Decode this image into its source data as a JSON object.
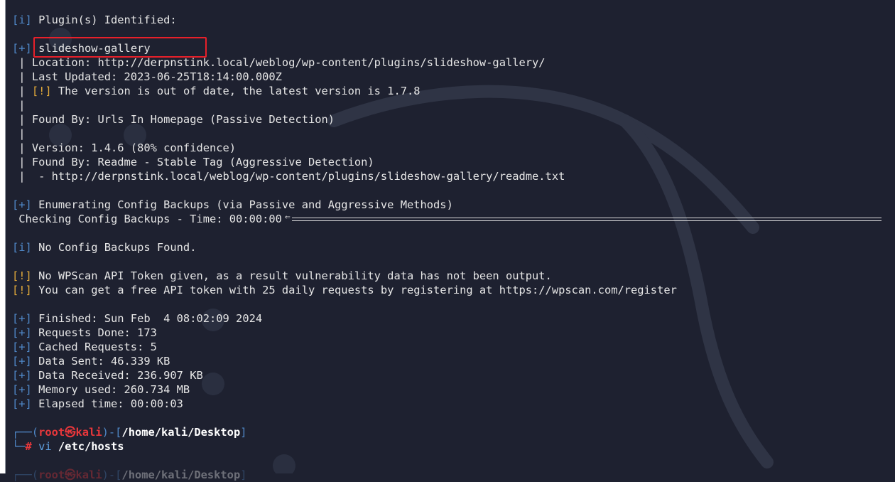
{
  "colors": {
    "background": "#1e2130",
    "tag": "#4f87c6",
    "warning": "#e0a83a",
    "highlight_box": "#e8202a",
    "prompt_root": "#e8373b"
  },
  "terminal": {
    "plugins_header": {
      "tag": "[i]",
      "text": " Plugin(s) Identified:"
    },
    "plugin": {
      "tag": "[+]",
      "name": "slideshow-gallery"
    },
    "details": {
      "location": " Location: http://derpnstink.local/weblog/wp-content/plugins/slideshow-gallery/",
      "last_updated": " Last Updated: 2023-06-25T18:14:00.000Z",
      "outdated_tag": "[!]",
      "outdated_text": " The version is out of date, the latest version is 1.7.8",
      "found_by_1": " Found By: Urls In Homepage (Passive Detection)",
      "version": " Version: 1.4.6 (80% confidence)",
      "found_by_2": " Found By: Readme - Stable Tag (Aggressive Detection)",
      "readme_url": "  - http://derpnstink.local/weblog/wp-content/plugins/slideshow-gallery/readme.txt"
    },
    "config": {
      "tag": "[+]",
      "enumerating": " Enumerating Config Backups (via Passive and Aggressive Methods)",
      "checking": " Checking Config Backups - Time: 00:00:00",
      "none_tag": "[i]",
      "none_text": " No Config Backups Found."
    },
    "warnings": [
      {
        "tag": "[!]",
        "text": " No WPScan API Token given, as a result vulnerability data has not been output."
      },
      {
        "tag": "[!]",
        "text": " You can get a free API token with 25 daily requests by registering at https://wpscan.com/register"
      }
    ],
    "stats": [
      {
        "tag": "[+]",
        "text": " Finished: Sun Feb  4 08:02:09 2024"
      },
      {
        "tag": "[+]",
        "text": " Requests Done: 173"
      },
      {
        "tag": "[+]",
        "text": " Cached Requests: 5"
      },
      {
        "tag": "[+]",
        "text": " Data Sent: 46.339 KB"
      },
      {
        "tag": "[+]",
        "text": " Data Received: 236.907 KB"
      },
      {
        "tag": "[+]",
        "text": " Memory used: 260.734 MB"
      },
      {
        "tag": "[+]",
        "text": " Elapsed time: 00:00:03"
      }
    ],
    "prompt": {
      "frame_open": "┌──(",
      "user": "root㉿kali",
      "frame_mid": ")-[",
      "path": "/home/kali/Desktop",
      "frame_close": "]",
      "line2_prefix": "└─",
      "hash": "#",
      "command_vi": " vi",
      "command_arg": " /etc/hosts"
    }
  }
}
